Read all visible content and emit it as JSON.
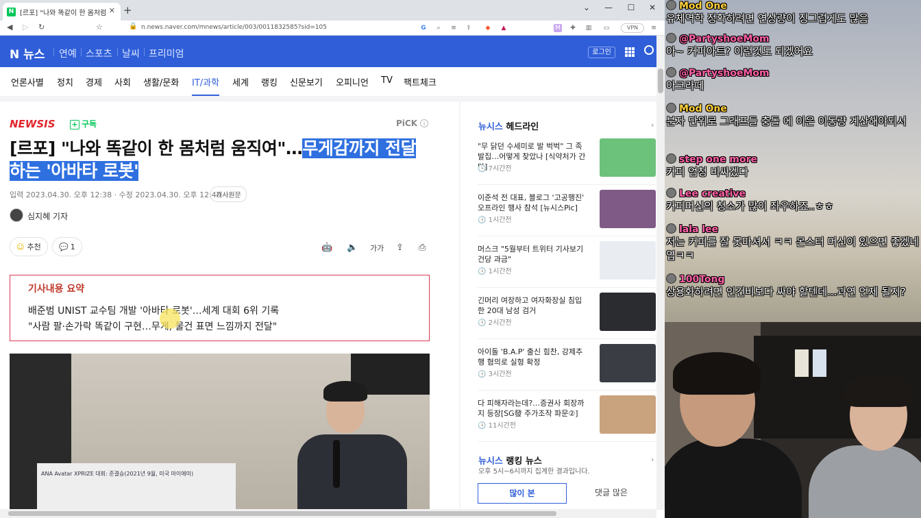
{
  "browser": {
    "tab_title": "[르포] \"나와 똑같이 한 몸처럼 움",
    "tab_favicon": "N",
    "url": "n.news.naver.com/mnews/article/003/0011832585?sid=105",
    "vpn_label": "VPN"
  },
  "naver": {
    "logo": "N 뉴스",
    "top_nav": [
      "연예",
      "스포츠",
      "날씨",
      "프리미엄"
    ],
    "login": "로그인",
    "categories": [
      "언론사별",
      "정치",
      "경제",
      "사회",
      "생활/문화",
      "IT/과학",
      "세계",
      "랭킹",
      "신문보기",
      "오피니언",
      "TV",
      "팩트체크"
    ],
    "active_category": "IT/과학"
  },
  "article": {
    "press": "NEWSIS",
    "subscribe": "구독",
    "pick": "PiCK",
    "headline_plain": "[르포] \"나와 똑같이 한 몸처럼 움직여\"…",
    "headline_highlight1": "무게감까지 전달",
    "headline_highlight2": "하는 '아바타 로봇'",
    "dateline": "입력 2023.04.30. 오후 12:38 · 수정 2023.04.30. 오후 12:40",
    "original_btn": "기사원문",
    "reporter": "심지혜 기자",
    "recommend": "추천",
    "comments": "1",
    "font_btn": "가가",
    "summary_title": "기사내용 요약",
    "summary_lines": [
      "배준범 UNIST 교수팀 개발 '아바타 로봇'…세계 대회 6위 기록",
      "\"사람 팔·손가락 똑같이 구현…무게, 물건 표면 느낌까지 전달\""
    ],
    "photo_caption": "ANA Avatar XPRIZE 대회: 준결승(2021년 9월, 미국 마이애미)"
  },
  "sidebar": {
    "headline_brand": "뉴시스",
    "headline_title": "헤드라인",
    "items": [
      {
        "title": "\"무 닭던 수세미로 발 벅벅\" 그 족발집…어떻게 찾았나 [식약처가 간다]",
        "time": "7시간전",
        "thumb_color": "#6cc17b"
      },
      {
        "title": "이준석 전 대표, 블로그 '고공행진' 오프라인 행사 참석 [뉴시스Pic]",
        "time": "1시간전",
        "thumb_color": "#7f5a86"
      },
      {
        "title": "머스크 \"5월부터 트위터 기사보기 건당 과금\"",
        "time": "1시간전",
        "thumb_color": "#e9edf2"
      },
      {
        "title": "긴머리 여장하고 여자화장실 침입한 20대 남성 검거",
        "time": "2시간전",
        "thumb_color": "#2a2c30"
      },
      {
        "title": "아이돌 'B.A.P' 출신 힘찬, 강제추행 혐의로 실형 확정",
        "time": "3시간전",
        "thumb_color": "#3a3d44"
      },
      {
        "title": "다 피해자라는데?…증권사 회장까지 등장[SG發 주가조작 파문②]",
        "time": "11시간전",
        "thumb_color": "#c9a27e"
      }
    ],
    "rank_brand": "뉴시스",
    "rank_title": "랭킹 뉴스",
    "rank_desc": "오후 5시~6시까지 집계한 결과입니다.",
    "rank_tabs": [
      "많이 본",
      "댓글 많은"
    ]
  },
  "chat": [
    {
      "name": "Mod One",
      "msg": "유체역학 정확하려면 연상량이 징그럽게도 많음",
      "color": "yellow"
    },
    {
      "name": "@PartyshoeMom",
      "msg": "아~ 커피아트? 이런것도 되겠어요",
      "color": "pink"
    },
    {
      "name": "@PartyshoeMom",
      "msg": "아크라떼",
      "color": "pink"
    },
    {
      "name": "Mod One",
      "msg": "분자 단위로 그래프들 충돌 에 이은 이동량 계산해야되서",
      "color": "yellow"
    },
    {
      "name": "step one more",
      "msg": "커피 엄청 비싸겠다",
      "color": "pink"
    },
    {
      "name": "Lee creative",
      "msg": "커피머신의 청소가 많이 좌우하죠..ㅎㅎ",
      "color": "pink"
    },
    {
      "name": "lala lee",
      "msg": "저는 커피를 잘 못마셔서 ㅋㅋ 몬스터 머신이 있으면 좋겠네엽ㅋㅋ",
      "color": "pink"
    },
    {
      "name": "100Tong",
      "msg": "상용화하려면 인건비보다 싸야 할텐데...과연 언제 될지?",
      "color": "pink"
    }
  ]
}
